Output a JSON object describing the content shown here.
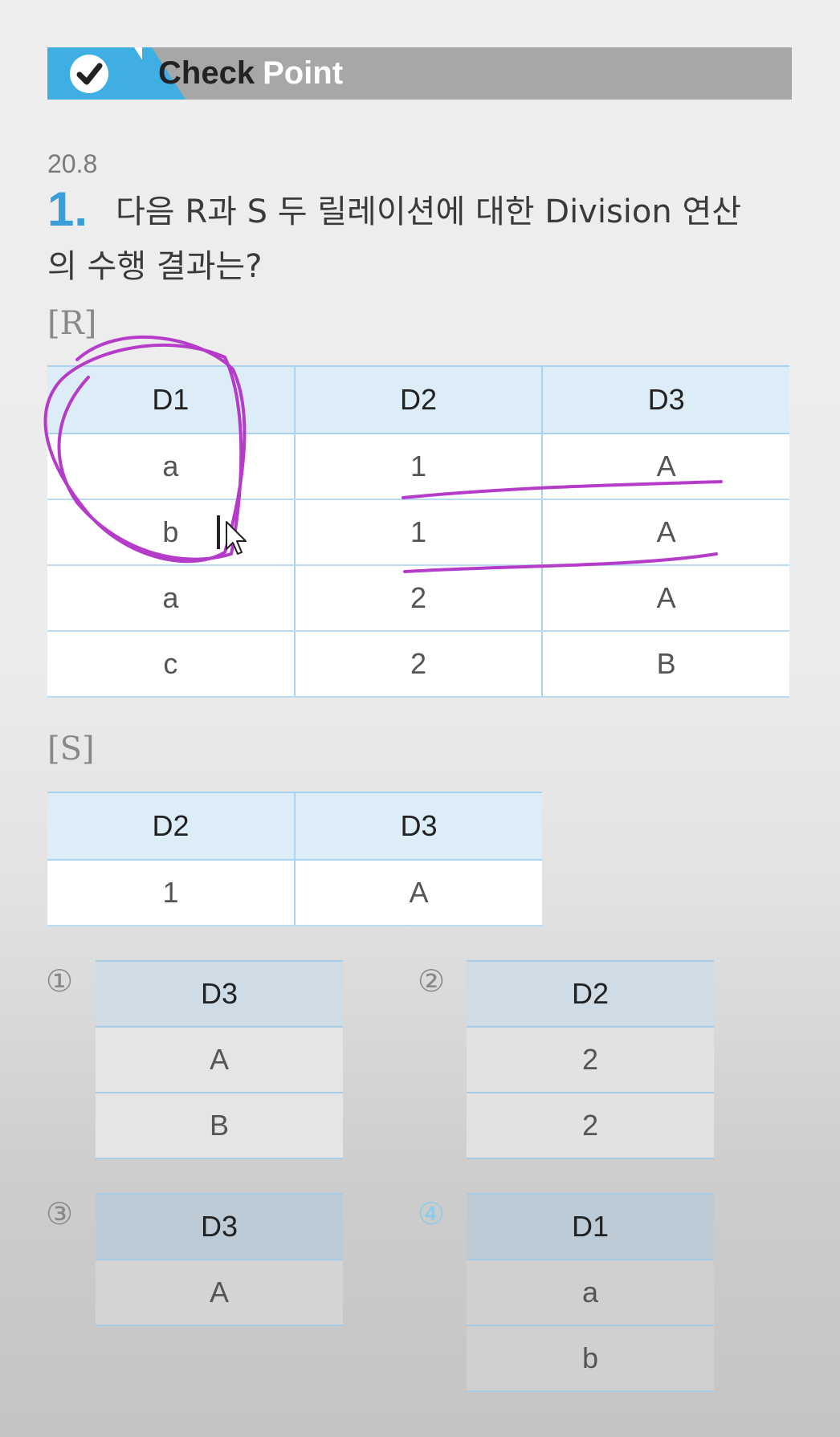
{
  "banner": {
    "title_check": "Check",
    "title_point": "Point"
  },
  "question": {
    "source": "20.8",
    "number": "1.",
    "text_line1": "다음 R과 S 두 릴레이션에 대한 Division 연산",
    "text_line2": "의 수행 결과는?"
  },
  "relation_r": {
    "label": "[R]",
    "headers": [
      "D1",
      "D2",
      "D3"
    ],
    "rows": [
      [
        "a",
        "1",
        "A"
      ],
      [
        "b",
        "1",
        "A"
      ],
      [
        "a",
        "2",
        "A"
      ],
      [
        "c",
        "2",
        "B"
      ]
    ]
  },
  "relation_s": {
    "label": "[S]",
    "headers": [
      "D2",
      "D3"
    ],
    "rows": [
      [
        "1",
        "A"
      ]
    ]
  },
  "choices": [
    {
      "number": "①",
      "header": "D3",
      "values": [
        "A",
        "B"
      ]
    },
    {
      "number": "②",
      "header": "D2",
      "values": [
        "2",
        "2"
      ]
    },
    {
      "number": "③",
      "header": "D3",
      "values": [
        "A"
      ]
    },
    {
      "number": "④",
      "header": "D1",
      "values": [
        "a",
        "b"
      ]
    }
  ],
  "colors": {
    "accent_blue": "#3eaee3",
    "annotation_magenta": "#b43cc8",
    "table_header": "#dcedf8"
  }
}
